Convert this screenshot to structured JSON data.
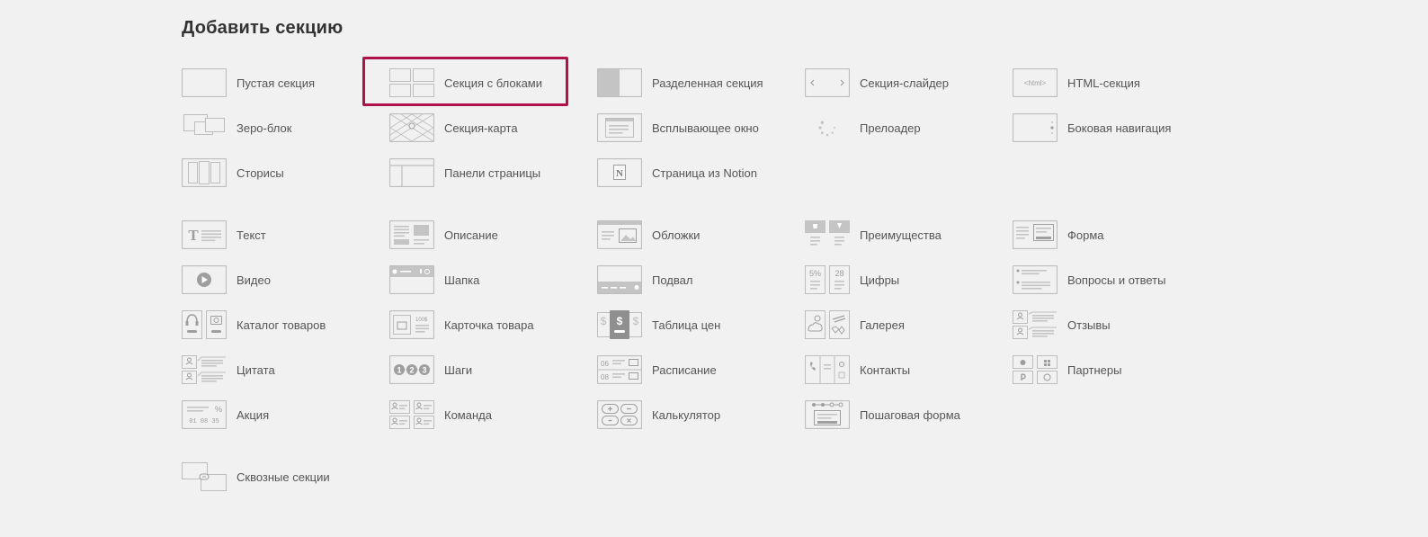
{
  "title": "Добавить секцию",
  "accent_color": "#b0114a",
  "groups": [
    [
      {
        "key": "empty",
        "icon": "empty-section-icon",
        "label": "Пустая секция"
      },
      {
        "key": "blocks",
        "icon": "blocks-grid-icon",
        "label": "Секция с блоками"
      },
      {
        "key": "split",
        "icon": "split-section-icon",
        "label": "Разделенная секция"
      },
      {
        "key": "slider",
        "icon": "slider-icon",
        "label": "Секция-слайдер"
      },
      {
        "key": "html",
        "icon": "html-icon",
        "icon_text": "<html>",
        "label": "HTML-секция"
      },
      {
        "key": "zero",
        "icon": "zero-block-icon",
        "label": "Зеро-блок"
      },
      {
        "key": "map",
        "icon": "map-icon",
        "label": "Секция-карта"
      },
      {
        "key": "popup",
        "icon": "popup-window-icon",
        "label": "Всплывающее окно"
      },
      {
        "key": "preloader",
        "icon": "preloader-spinner-icon",
        "label": "Прелоадер"
      },
      {
        "key": "sidenav",
        "icon": "side-navigation-icon",
        "label": "Боковая навигация"
      },
      {
        "key": "stories",
        "icon": "stories-icon",
        "label": "Сторисы"
      },
      {
        "key": "panels",
        "icon": "page-panels-icon",
        "label": "Панели страницы"
      },
      {
        "key": "notion",
        "icon": "notion-icon",
        "icon_text": "N",
        "label": "Страница из Notion"
      }
    ],
    [
      {
        "key": "text",
        "icon": "text-icon",
        "icon_text": "T",
        "label": "Текст"
      },
      {
        "key": "description",
        "icon": "description-icon",
        "label": "Описание"
      },
      {
        "key": "covers",
        "icon": "cover-icon",
        "label": "Обложки"
      },
      {
        "key": "features",
        "icon": "features-icon",
        "label": "Преимущества"
      },
      {
        "key": "form",
        "icon": "form-icon",
        "label": "Форма"
      },
      {
        "key": "video",
        "icon": "video-play-icon",
        "label": "Видео"
      },
      {
        "key": "header",
        "icon": "header-bar-icon",
        "label": "Шапка"
      },
      {
        "key": "footer",
        "icon": "footer-bar-icon",
        "label": "Подвал"
      },
      {
        "key": "numbers",
        "icon": "numbers-icon",
        "icon_text_a": "5%",
        "icon_text_b": "28",
        "label": "Цифры"
      },
      {
        "key": "faq",
        "icon": "faq-list-icon",
        "label": "Вопросы и ответы"
      },
      {
        "key": "catalog",
        "icon": "catalog-products-icon",
        "label": "Каталог товаров"
      },
      {
        "key": "product",
        "icon": "product-card-icon",
        "icon_text": "100$",
        "label": "Карточка товара"
      },
      {
        "key": "pricing",
        "icon": "price-table-icon",
        "icon_text": "$",
        "label": "Таблица цен"
      },
      {
        "key": "gallery",
        "icon": "gallery-icon",
        "label": "Галерея"
      },
      {
        "key": "reviews",
        "icon": "reviews-icon",
        "label": "Отзывы"
      },
      {
        "key": "quote",
        "icon": "quote-icon",
        "label": "Цитата"
      },
      {
        "key": "steps",
        "icon": "steps-icon",
        "icon_text_a": "1",
        "icon_text_b": "2",
        "icon_text_c": "3",
        "label": "Шаги"
      },
      {
        "key": "schedule",
        "icon": "schedule-icon",
        "icon_text_a": "06",
        "icon_text_b": "08",
        "label": "Расписание"
      },
      {
        "key": "contacts",
        "icon": "contacts-icon",
        "label": "Контакты"
      },
      {
        "key": "partners",
        "icon": "partners-logos-icon",
        "label": "Партнеры"
      },
      {
        "key": "promo",
        "icon": "promo-timer-icon",
        "icon_text_a": "%",
        "icon_text_b": "01 08 35",
        "label": "Акция"
      },
      {
        "key": "team",
        "icon": "team-icon",
        "label": "Команда"
      },
      {
        "key": "calculator",
        "icon": "calculator-icon",
        "label": "Калькулятор"
      },
      {
        "key": "stepform",
        "icon": "step-form-icon",
        "label": "Пошаговая форма"
      }
    ],
    [
      {
        "key": "cross",
        "icon": "linked-sections-icon",
        "label": "Сквозные секции"
      }
    ]
  ]
}
